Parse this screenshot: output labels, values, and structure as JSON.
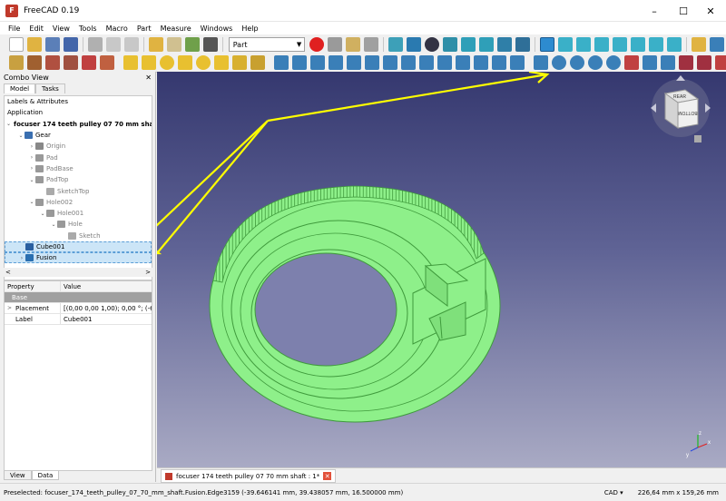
{
  "window": {
    "title": "FreeCAD 0.19",
    "min": "–",
    "max": "☐",
    "close": "✕"
  },
  "menu": [
    "File",
    "Edit",
    "View",
    "Tools",
    "Macro",
    "Part",
    "Measure",
    "Windows",
    "Help"
  ],
  "workbench": {
    "selected": "Part"
  },
  "combo_view": {
    "title": "Combo View",
    "tabs": [
      "Model",
      "Tasks"
    ],
    "active_tab": "Model",
    "section": "Labels & Attributes",
    "application_label": "Application",
    "tree": [
      {
        "label": "focuser 174 teeth pulley 07 70 mm shaft",
        "indent": 0,
        "arrow": "v",
        "bold": true,
        "icon": "document-icon"
      },
      {
        "label": "Gear",
        "indent": 1,
        "arrow": "v",
        "icon": "body-icon"
      },
      {
        "label": "Origin",
        "indent": 2,
        "arrow": ">",
        "grey": true,
        "icon": "origin-icon"
      },
      {
        "label": "Pad",
        "indent": 2,
        "arrow": ">",
        "grey": true,
        "icon": "pad-icon"
      },
      {
        "label": "PadBase",
        "indent": 2,
        "arrow": ">",
        "grey": true,
        "icon": "pad-icon"
      },
      {
        "label": "PadTop",
        "indent": 2,
        "arrow": "v",
        "grey": true,
        "icon": "pad-icon"
      },
      {
        "label": "SketchTop",
        "indent": 3,
        "arrow": "",
        "grey": true,
        "icon": "sketch-icon"
      },
      {
        "label": "Hole002",
        "indent": 2,
        "arrow": "v",
        "grey": true,
        "icon": "hole-icon"
      },
      {
        "label": "Hole001",
        "indent": 3,
        "arrow": "v",
        "grey": true,
        "icon": "hole-icon"
      },
      {
        "label": "Hole",
        "indent": 4,
        "arrow": "v",
        "grey": true,
        "icon": "hole-icon"
      },
      {
        "label": "Sketch",
        "indent": 5,
        "arrow": "",
        "grey": true,
        "icon": "sketch-icon"
      },
      {
        "label": "Cube001",
        "indent": 1,
        "arrow": "",
        "selected": true,
        "icon": "cube-icon"
      },
      {
        "label": "Fusion",
        "indent": 1,
        "arrow": ">",
        "selected": true,
        "icon": "fusion-icon"
      }
    ],
    "properties": {
      "headers": [
        "Property",
        "Value"
      ],
      "group": "Base",
      "rows": [
        {
          "name": "Placement",
          "value": "[(0,00 0,00 1,00); 0,00 °; (-6..."
        },
        {
          "name": "Label",
          "value": "Cube001"
        }
      ]
    },
    "bottom_tabs": [
      "View",
      "Data"
    ],
    "active_bottom_tab": "Data"
  },
  "document_tab": {
    "label": "focuser 174 teeth pulley 07 70 mm shaft : 1*"
  },
  "navcube": {
    "top_face": "REAR",
    "front_face": "BOTTOM"
  },
  "axis": {
    "x": "x",
    "y": "y",
    "z": "z"
  },
  "statusbar": {
    "message": "Preselected: focuser_174_teeth_pulley_07_70_mm_shaft.Fusion.Edge3159 (-39.646141 mm, 39.438057 mm, 16.500000 mm)",
    "nav_style": "CAD",
    "dimensions": "226,64 mm x 159,26 mm"
  },
  "colors": {
    "model_green": "#8ef08a",
    "annotation_yellow": "#ffff00",
    "selection_blue": "#cce5f7"
  }
}
